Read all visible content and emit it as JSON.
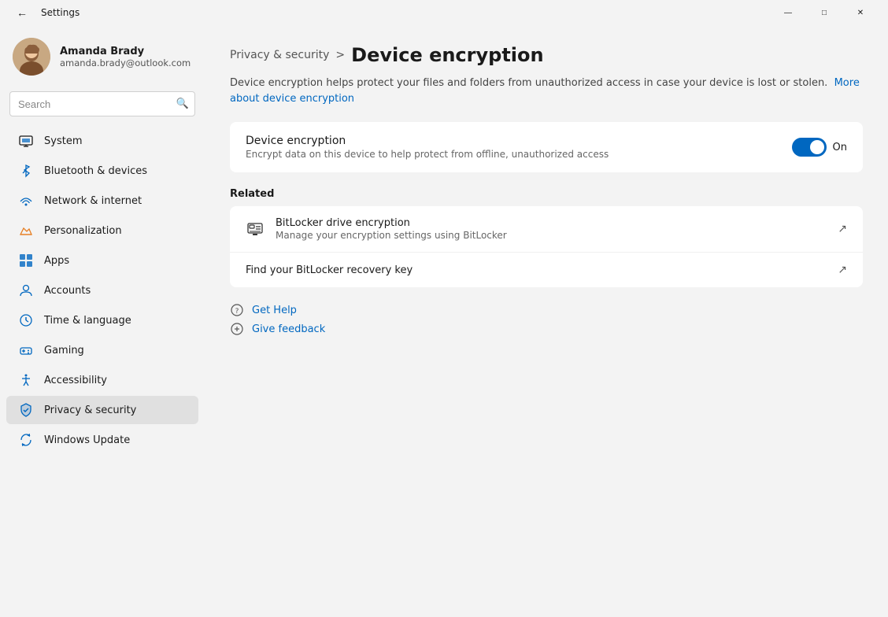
{
  "titleBar": {
    "title": "Settings",
    "backLabel": "←",
    "minimizeLabel": "—",
    "maximizeLabel": "□",
    "closeLabel": "✕"
  },
  "sidebar": {
    "user": {
      "name": "Amanda Brady",
      "email": "amanda.brady@outlook.com"
    },
    "search": {
      "placeholder": "Search"
    },
    "navItems": [
      {
        "id": "system",
        "label": "System",
        "icon": "system"
      },
      {
        "id": "bluetooth",
        "label": "Bluetooth & devices",
        "icon": "bluetooth"
      },
      {
        "id": "network",
        "label": "Network & internet",
        "icon": "network"
      },
      {
        "id": "personalization",
        "label": "Personalization",
        "icon": "personalization"
      },
      {
        "id": "apps",
        "label": "Apps",
        "icon": "apps"
      },
      {
        "id": "accounts",
        "label": "Accounts",
        "icon": "accounts"
      },
      {
        "id": "time",
        "label": "Time & language",
        "icon": "time"
      },
      {
        "id": "gaming",
        "label": "Gaming",
        "icon": "gaming"
      },
      {
        "id": "accessibility",
        "label": "Accessibility",
        "icon": "accessibility"
      },
      {
        "id": "privacy",
        "label": "Privacy & security",
        "icon": "privacy",
        "active": true
      },
      {
        "id": "update",
        "label": "Windows Update",
        "icon": "update"
      }
    ]
  },
  "content": {
    "breadcrumb": {
      "parent": "Privacy & security",
      "separator": ">",
      "current": "Device encryption"
    },
    "description": "Device encryption helps protect your files and folders from unauthorized access in case your device is lost or stolen.",
    "descriptionLink": "More about device encryption",
    "deviceEncryption": {
      "title": "Device encryption",
      "description": "Encrypt data on this device to help protect from offline, unauthorized access",
      "toggleState": true,
      "toggleLabel": "On"
    },
    "related": {
      "sectionTitle": "Related",
      "items": [
        {
          "id": "bitlocker",
          "title": "BitLocker drive encryption",
          "description": "Manage your encryption settings using BitLocker",
          "hasIcon": true,
          "external": true
        },
        {
          "id": "recovery-key",
          "title": "Find your BitLocker recovery key",
          "description": "",
          "hasIcon": false,
          "external": true
        }
      ]
    },
    "help": {
      "getHelp": "Get Help",
      "giveFeedback": "Give feedback"
    }
  }
}
